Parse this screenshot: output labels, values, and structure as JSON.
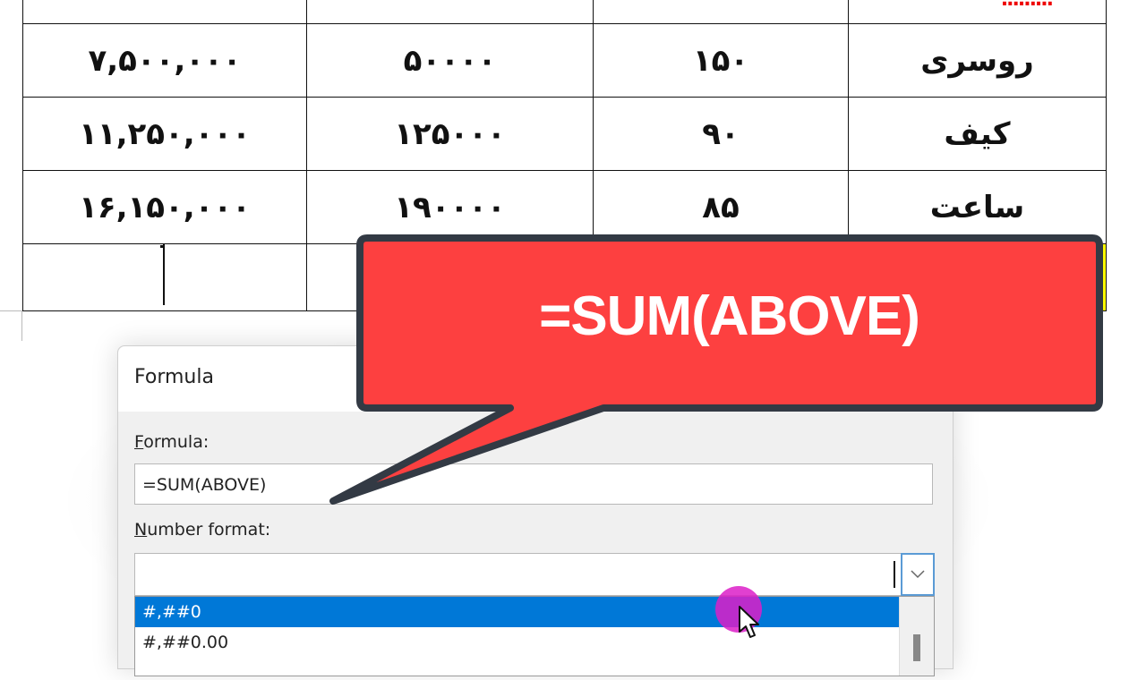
{
  "document": {
    "table": {
      "header_partial": {
        "name": "",
        "note": "misspelled word (red underline)"
      },
      "rows": [
        {
          "total": "۷,۵۰۰,۰۰۰",
          "price": "۵۰۰۰۰",
          "quantity": "۱۵۰",
          "item": "روسری"
        },
        {
          "total": "۱۱,۲۵۰,۰۰۰",
          "price": "۱۲۵۰۰۰",
          "quantity": "۹۰",
          "item": "کیف"
        },
        {
          "total": "۱۶,۱۵۰,۰۰۰",
          "price": "۱۹۰۰۰۰",
          "quantity": "۸۵",
          "item": "ساعت"
        }
      ],
      "total_row": {
        "highlight_color": "#ffff00"
      }
    }
  },
  "dialog": {
    "title": "Formula",
    "formula_label_accel": "F",
    "formula_label_rest": "ormula:",
    "formula_value": "=SUM(ABOVE)",
    "number_format_label_accel": "N",
    "number_format_label_rest": "umber format:",
    "number_format_value": "",
    "number_format_options": [
      "#,##0",
      "#,##0.00"
    ],
    "selected_option": "#,##0"
  },
  "callout": {
    "text": "=SUM(ABOVE)",
    "fill_color": "#fd4040",
    "border_color": "#333a44"
  },
  "colors": {
    "selection_blue": "#0078d7",
    "click_indicator": "#dc1ec8"
  }
}
